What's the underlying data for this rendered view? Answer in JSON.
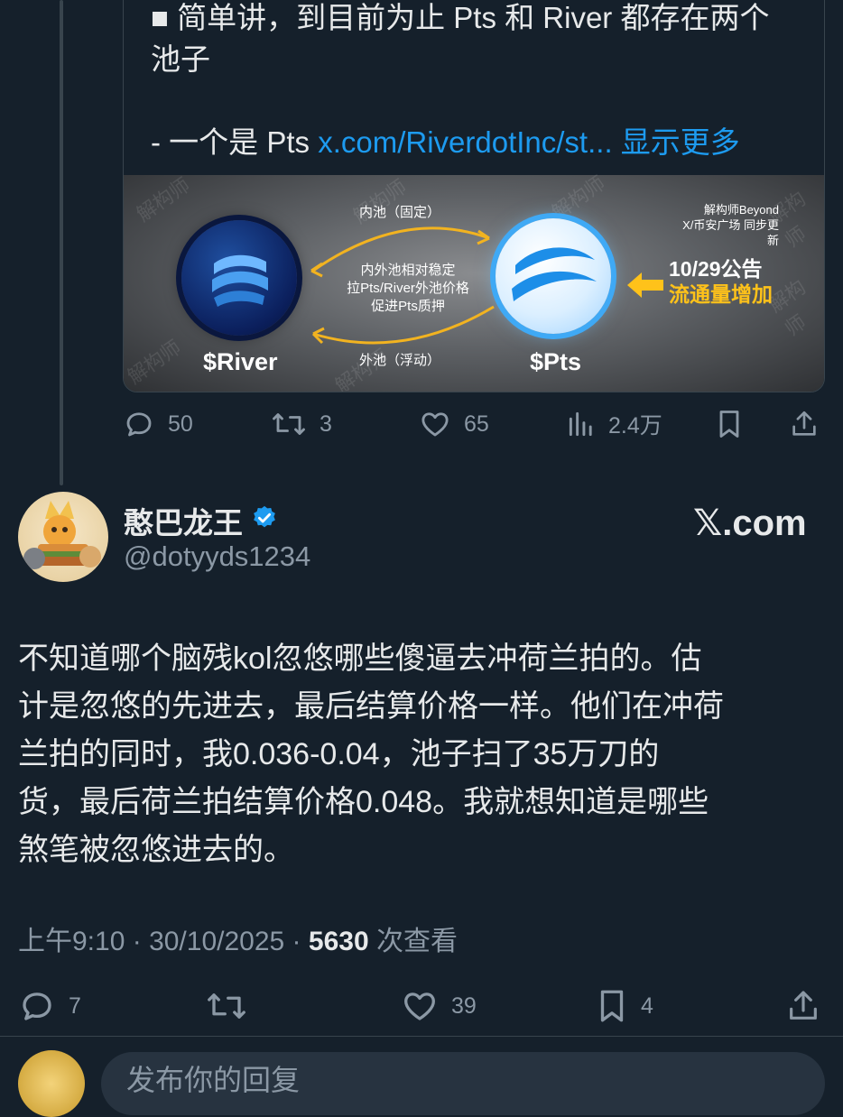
{
  "quoted": {
    "text_line1": "■ 简单讲，到目前为止 Pts 和 River 都存在两个",
    "text_line2": "池子",
    "text_line3_prefix": "- 一个是 Pts ",
    "link_text": "x.com/RiverdotInc/st...",
    "show_more": "显示更多",
    "image": {
      "label_river": "$River",
      "label_pts": "$Pts",
      "inner_pool": "内池（固定）",
      "outer_pool": "外池（浮动）",
      "middle_line1": "内外池相对稳定",
      "middle_line2": "拉Pts/River外池价格",
      "middle_line3": "促进Pts质押",
      "notice_line1": "10/29公告",
      "notice_line2": "流通量增加",
      "brand_line1": "解构师Beyond",
      "brand_line2": "X/币安广场 同步更新",
      "watermark": "解构师"
    },
    "actions": {
      "replies": "50",
      "reposts": "3",
      "likes": "65",
      "views": "2.4万"
    }
  },
  "tweet": {
    "author_name": "憨巴龙王",
    "author_handle": "@dotyyds1234",
    "source": "𝕏.com",
    "lines": [
      "不知道哪个脑残kol忽悠哪些傻逼去冲荷兰拍的。估",
      "计是忽悠的先进去，最后结算价格一样。他们在冲荷",
      "兰拍的同时，我0.036-0.04，池子扫了35万刀的",
      "货，最后荷兰拍结算价格0.048。我就想知道是哪些",
      "煞笔被忽悠进去的。"
    ],
    "time": "上午9:10",
    "date": "30/10/2025",
    "views_count": "5630",
    "views_label": " 次查看",
    "actions": {
      "replies": "7",
      "likes": "39",
      "bookmarks": "4"
    }
  },
  "reply": {
    "placeholder": "发布你的回复"
  },
  "colors": {
    "background": "#15202b",
    "link": "#1d9bf0",
    "muted": "#8b98a5",
    "verified": "#1d9bf0"
  }
}
